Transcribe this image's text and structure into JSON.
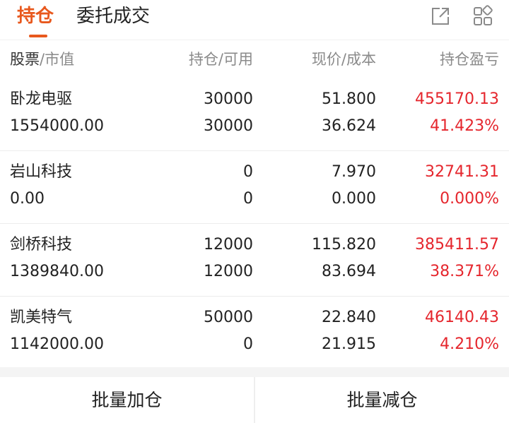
{
  "tabs": {
    "holdings": "持仓",
    "orders": "委托成交"
  },
  "header_icons": [
    "export-icon",
    "grid-icon"
  ],
  "columns": {
    "stock": "股票",
    "market_value": "/市值",
    "position": "持仓/可用",
    "price": "现价/成本",
    "pnl": "持仓盈亏"
  },
  "holdings": [
    {
      "name": "卧龙电驱",
      "market_value": "1554000.00",
      "quantity": "30000",
      "available": "30000",
      "price": "51.800",
      "cost": "36.624",
      "pnl": "455170.13",
      "pnl_pct": "41.423%"
    },
    {
      "name": "岩山科技",
      "market_value": "0.00",
      "quantity": "0",
      "available": "0",
      "price": "7.970",
      "cost": "0.000",
      "pnl": "32741.31",
      "pnl_pct": "0.000%"
    },
    {
      "name": "剑桥科技",
      "market_value": "1389840.00",
      "quantity": "12000",
      "available": "12000",
      "price": "115.820",
      "cost": "83.694",
      "pnl": "385411.57",
      "pnl_pct": "38.371%"
    },
    {
      "name": "凯美特气",
      "market_value": "1142000.00",
      "quantity": "50000",
      "available": "0",
      "price": "22.840",
      "cost": "21.915",
      "pnl": "46140.43",
      "pnl_pct": "4.210%"
    }
  ],
  "actions": {
    "batch_add": "批量加仓",
    "batch_reduce": "批量减仓"
  },
  "colors": {
    "accent": "#e8581d",
    "profit": "#e5262d"
  }
}
